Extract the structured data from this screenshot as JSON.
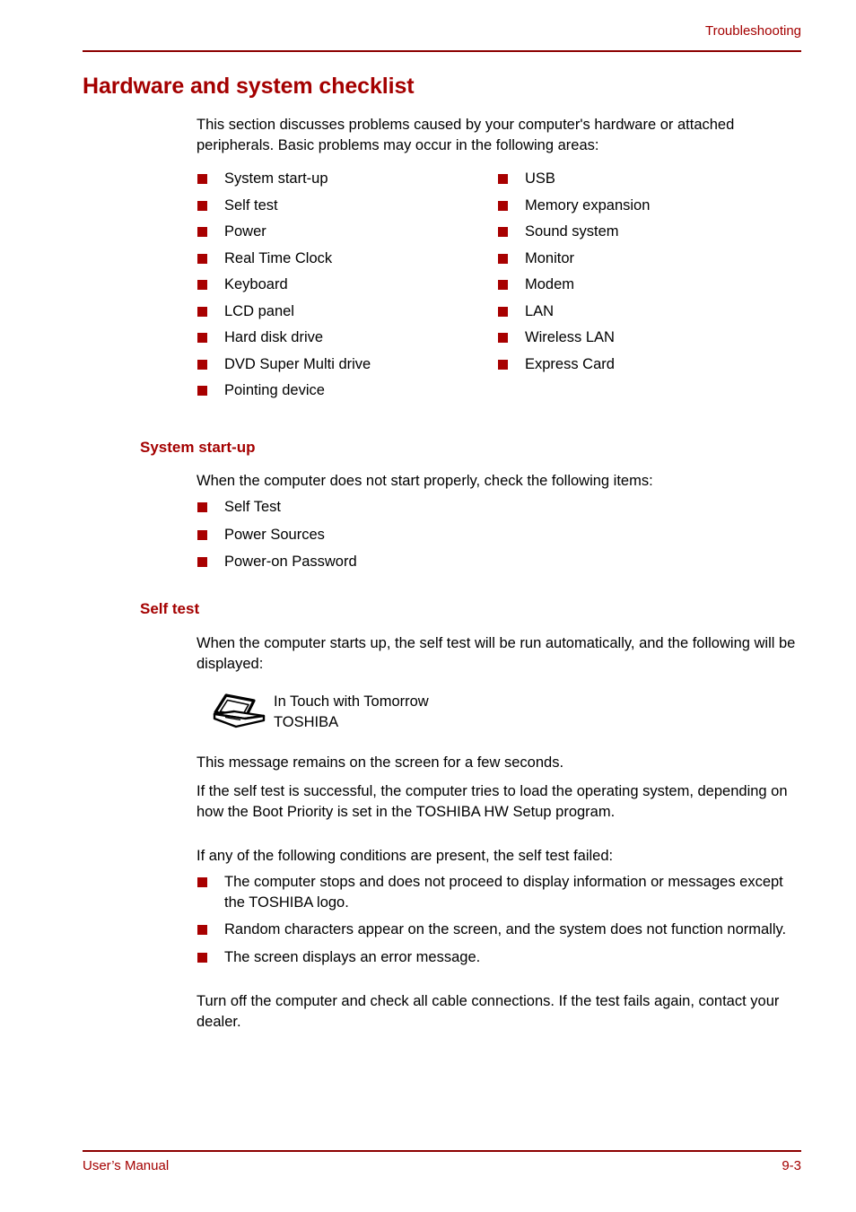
{
  "header": {
    "running_head": "Troubleshooting"
  },
  "footer": {
    "left": "User’s Manual",
    "page_number": "9-3"
  },
  "colors": {
    "accent_red": "#A40000",
    "bullet_red": "#A80000",
    "rule_red": "#8C0000",
    "body_black": "#000000"
  },
  "chapter": {
    "title": "Hardware and system checklist",
    "intro": "This section discusses problems caused by your computer's hardware or attached peripherals. Basic problems may occur in the following areas:",
    "areas_left": [
      "System start-up",
      "Self test",
      "Power",
      "Real Time Clock",
      "Keyboard",
      "LCD panel",
      "Hard disk drive",
      "DVD Super Multi drive",
      "Pointing device"
    ],
    "areas_right": [
      "USB",
      "Memory expansion",
      "Sound system",
      "Monitor",
      "Modem",
      "LAN",
      "Wireless LAN",
      "Express Card"
    ]
  },
  "system_startup": {
    "heading": "System start-up",
    "intro": "When the computer does not start properly, check the following items:",
    "items": [
      "Self Test",
      "Power Sources",
      "Power-on Password"
    ]
  },
  "self_test": {
    "heading": "Self test",
    "intro": "When the computer starts up, the self test will be run automatically, and the following will be displayed:",
    "logo": {
      "icon": "laptop-icon",
      "line1": "In Touch with Tomorrow",
      "line2": "TOSHIBA"
    },
    "para_remains": "This message remains on the screen for a few seconds.",
    "para_success": "If the self test is successful, the computer tries to load the operating system, depending on how the Boot Priority is set in the TOSHIBA HW Setup program.",
    "para_conditions_lead": "If any of the following conditions are present, the self test failed:",
    "failure_conditions": [
      "The computer stops and does not proceed to display information or messages except the TOSHIBA logo.",
      "Random characters appear on the screen, and the system does not function normally.",
      "The screen displays an error message."
    ],
    "para_closing": "Turn off the computer and check all cable connections. If the test fails again, contact your dealer."
  }
}
